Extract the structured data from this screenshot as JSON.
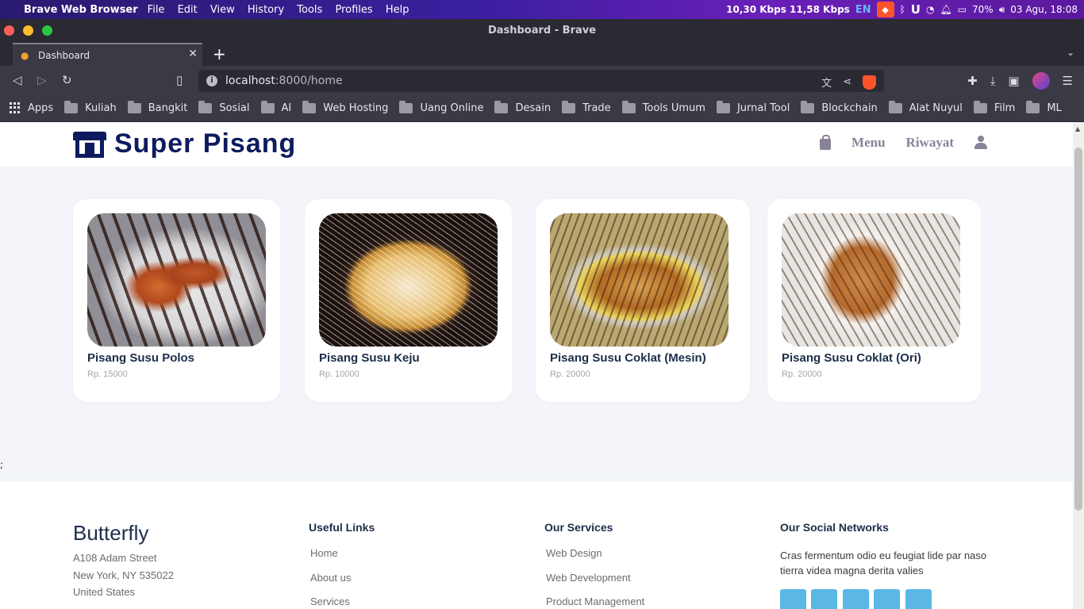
{
  "os_menubar": {
    "app_name": "Brave Web Browser",
    "menus": [
      "File",
      "Edit",
      "View",
      "History",
      "Tools",
      "Profiles",
      "Help"
    ],
    "net_speed": "10,30 Kbps 11,58 Kbps",
    "lang": "EN",
    "battery": "70%",
    "datetime": "03 Agu, 18:08"
  },
  "window": {
    "title": "Dashboard - Brave"
  },
  "tab": {
    "title": "Dashboard"
  },
  "address_bar": {
    "host": "localhost",
    "path": ":8000/home"
  },
  "bookmarks": [
    "Apps",
    "Kuliah",
    "Bangkit",
    "Sosial",
    "AI",
    "Web Hosting",
    "Uang Online",
    "Desain",
    "Trade",
    "Tools Umum",
    "Jurnal Tool",
    "Blockchain",
    "Alat Nuyul",
    "Film",
    "ML"
  ],
  "site": {
    "brand": "Super Pisang",
    "nav": {
      "menu": "Menu",
      "history": "Riwayat"
    }
  },
  "products": [
    {
      "name": "Pisang Susu Polos",
      "price": "Rp. 15000"
    },
    {
      "name": "Pisang Susu Keju",
      "price": "Rp. 10000"
    },
    {
      "name": "Pisang Susu Coklat (Mesin)",
      "price": "Rp. 20000"
    },
    {
      "name": "Pisang Susu Coklat (Ori)",
      "price": "Rp. 20000"
    }
  ],
  "stray_text": ";",
  "footer": {
    "brand": "Butterfly",
    "address": [
      "A108 Adam Street",
      "New York, NY 535022",
      "United States"
    ],
    "useful_links": {
      "heading": "Useful Links",
      "items": [
        "Home",
        "About us",
        "Services"
      ]
    },
    "services": {
      "heading": "Our Services",
      "items": [
        "Web Design",
        "Web Development",
        "Product Management"
      ]
    },
    "social": {
      "heading": "Our Social Networks",
      "text": "Cras fermentum odio eu feugiat lide par naso tierra videa magna derita valies"
    }
  },
  "colors": {
    "brand_navy": "#0d1b5e",
    "nav_gray": "#8a8298",
    "social_blue": "#5bb7e6"
  }
}
